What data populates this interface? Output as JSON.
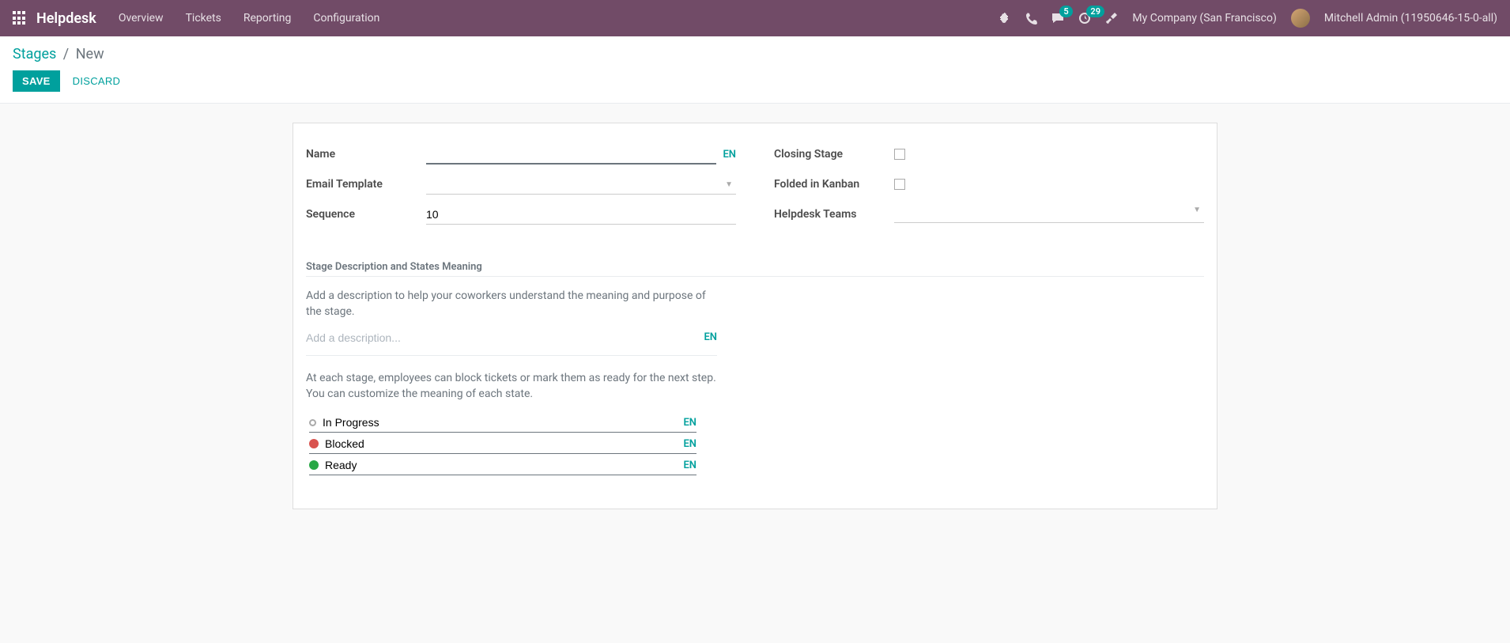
{
  "navbar": {
    "brand": "Helpdesk",
    "menu": [
      "Overview",
      "Tickets",
      "Reporting",
      "Configuration"
    ],
    "messages_badge": "5",
    "activities_badge": "29",
    "company": "My Company (San Francisco)",
    "user": "Mitchell Admin (11950646-15-0-all)"
  },
  "breadcrumb": {
    "root": "Stages",
    "current": "New"
  },
  "buttons": {
    "save": "SAVE",
    "discard": "DISCARD"
  },
  "form": {
    "labels": {
      "name": "Name",
      "email_template": "Email Template",
      "sequence": "Sequence",
      "closing_stage": "Closing Stage",
      "folded": "Folded in Kanban",
      "teams": "Helpdesk Teams"
    },
    "values": {
      "name": "",
      "sequence": "10"
    },
    "lang": "EN"
  },
  "section": {
    "title": "Stage Description and States Meaning",
    "desc_help": "Add a description to help your coworkers understand the meaning and purpose of the stage.",
    "desc_placeholder": "Add a description...",
    "states_help": "At each stage, employees can block tickets or mark them as ready for the next step. You can customize the meaning of each state.",
    "states": {
      "normal": "In Progress",
      "blocked": "Blocked",
      "done": "Ready"
    }
  }
}
